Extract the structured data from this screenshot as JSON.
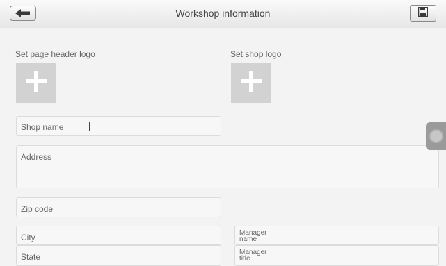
{
  "header": {
    "title": "Workshop information"
  },
  "logos": {
    "page_header_label": "Set page header logo",
    "shop_label": "Set shop logo"
  },
  "form": {
    "shop_name_label": "Shop name",
    "address_label": "Address",
    "zip_label": "Zip code",
    "city_label": "City",
    "state_label": "State",
    "manager_name_label": [
      "Manager",
      "name"
    ],
    "manager_title_label": [
      "Manager",
      "title"
    ]
  },
  "icons": {
    "back": "back-arrow-icon",
    "save": "floppy-disk-icon",
    "add": "plus-icon"
  },
  "colors": {
    "background": "#f3f3f3",
    "tile": "#d2d2d2",
    "handle": "#9a9a9a"
  }
}
